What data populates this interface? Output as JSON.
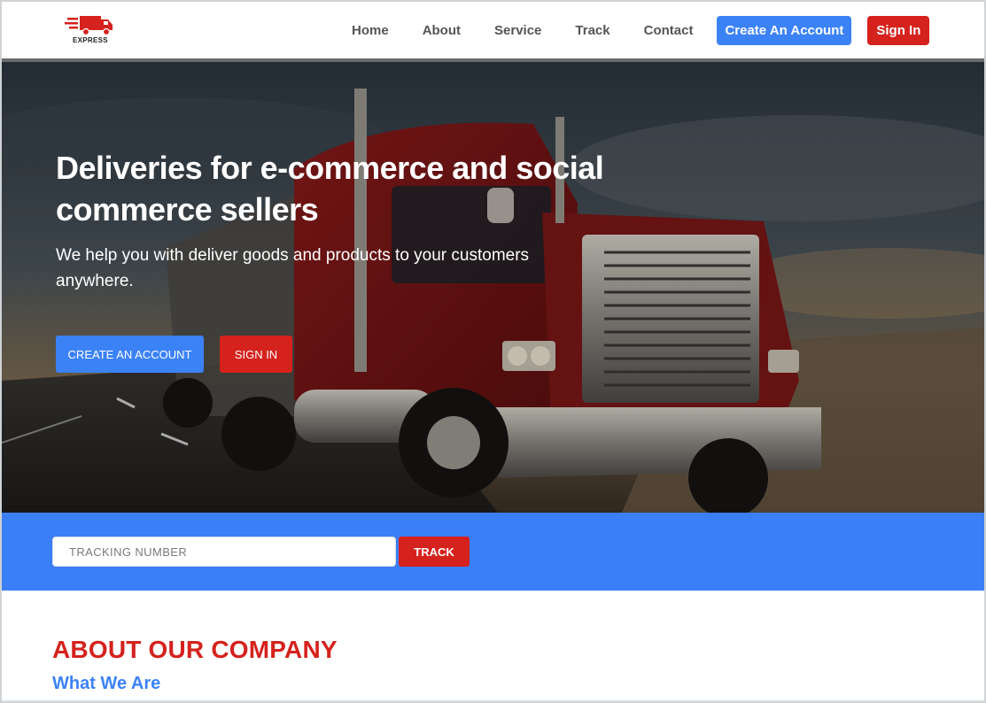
{
  "brand": {
    "logo_text": "EXPRESS"
  },
  "nav": {
    "links": [
      "Home",
      "About",
      "Service",
      "Track",
      "Contact"
    ],
    "create_account": "Create An Account",
    "sign_in": "Sign In"
  },
  "hero": {
    "title": "Deliveries for e-commerce and social commerce sellers",
    "subtitle": "We help you with deliver goods and products to your customers anywhere.",
    "create_account": "CREATE AN ACCOUNT",
    "sign_in": "SIGN IN"
  },
  "tracking": {
    "placeholder": "TRACKING NUMBER",
    "button": "TRACK"
  },
  "about": {
    "title": "ABOUT OUR COMPANY",
    "subtitle": "What We Are"
  },
  "colors": {
    "brand_blue": "#3b82f6",
    "brand_red": "#d5221d"
  }
}
